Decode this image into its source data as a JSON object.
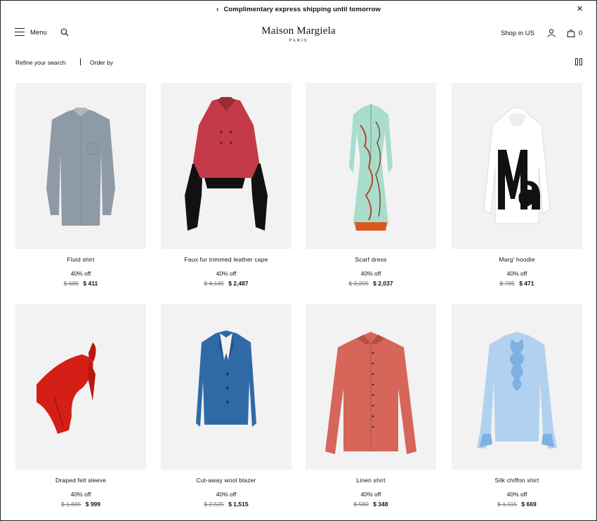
{
  "promo": {
    "chevron": "›",
    "text": "Complimentary express shipping until tomorrow",
    "close_icon": "×"
  },
  "header": {
    "menu_label": "Menu",
    "brand": "Maison Margiela",
    "city": "PARIS",
    "shop_in": "Shop in US",
    "bag_count": "0",
    "icons": [
      "hamburger-icon",
      "search-icon",
      "user-icon",
      "bag-icon"
    ]
  },
  "toolbar": {
    "refine": "Refine your search",
    "order_by": "Order by",
    "icons": [
      "grid-view-icon"
    ]
  },
  "products": [
    {
      "name": "Fluid shirt",
      "discount": "40% off",
      "old_price": "$ 685",
      "new_price": "$ 411",
      "colors": [
        "#8e9aa6",
        "#aeb8c2"
      ]
    },
    {
      "name": "Faux fur trimmed leather cape",
      "discount": "40% off",
      "old_price": "$ 4,145",
      "new_price": "$ 2,487",
      "colors": [
        "#c43a48",
        "#111111"
      ]
    },
    {
      "name": "Scarf dress",
      "discount": "40% off",
      "old_price": "$ 3,395",
      "new_price": "$ 2,037",
      "colors": [
        "#a9dccb",
        "#d9581f"
      ]
    },
    {
      "name": "Marg' hoodie",
      "discount": "40% off",
      "old_price": "$ 785",
      "new_price": "$ 471",
      "colors": [
        "#ffffff",
        "#111111"
      ]
    },
    {
      "name": "Draped felt sleeve",
      "discount": "40% off",
      "old_price": "$ 1,665",
      "new_price": "$ 999",
      "colors": [
        "#d41e16",
        "#b81712"
      ]
    },
    {
      "name": "Cut-away wool blazer",
      "discount": "40% off",
      "old_price": "$ 2,525",
      "new_price": "$ 1,515",
      "colors": [
        "#2f6aa6",
        "#24568a"
      ]
    },
    {
      "name": "Linen shirt",
      "discount": "40% off",
      "old_price": "$ 580",
      "new_price": "$ 348",
      "colors": [
        "#d6665a",
        "#b84d42"
      ]
    },
    {
      "name": "Silk chiffon shirt",
      "discount": "40% off",
      "old_price": "$ 1,115",
      "new_price": "$ 669",
      "colors": [
        "#aecfef",
        "#7fb0e2"
      ]
    }
  ]
}
